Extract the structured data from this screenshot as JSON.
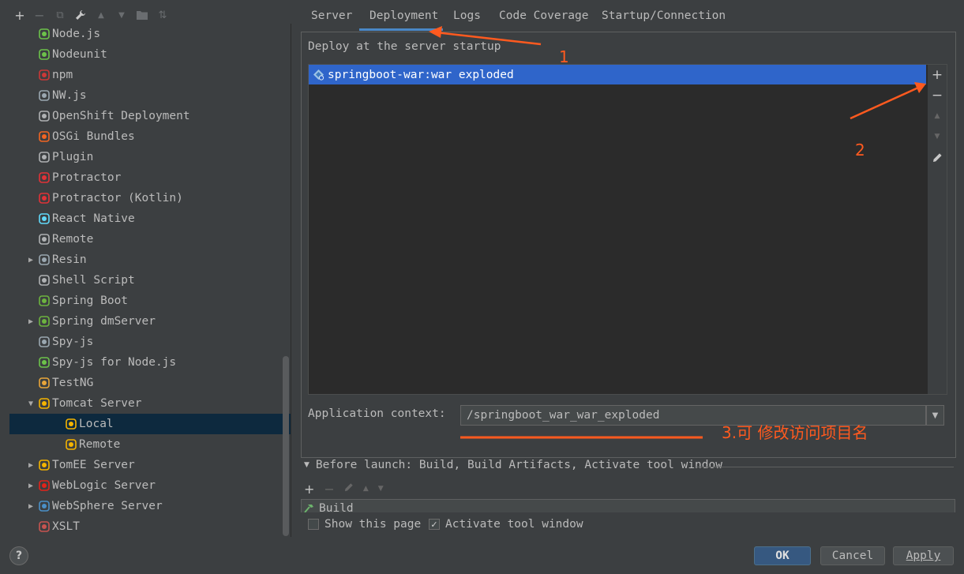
{
  "toolbar": {
    "add": "+",
    "remove": "−",
    "copy": "⧉",
    "settings": "🔧",
    "up": "▲",
    "down": "▼",
    "folder": "📁",
    "sort": "⇅"
  },
  "tree": [
    {
      "label": "Node.js",
      "icon": "nodejs-icon",
      "color": "#6cc24a",
      "arrow": ""
    },
    {
      "label": "Nodeunit",
      "icon": "nodeunit-icon",
      "color": "#6cc24a",
      "arrow": ""
    },
    {
      "label": "npm",
      "icon": "npm-icon",
      "color": "#cb3837",
      "arrow": ""
    },
    {
      "label": "NW.js",
      "icon": "nwjs-icon",
      "color": "#9aa7b0",
      "arrow": ""
    },
    {
      "label": "OpenShift Deployment",
      "icon": "openshift-icon",
      "color": "#afb1b3",
      "arrow": ""
    },
    {
      "label": "OSGi Bundles",
      "icon": "osgi-icon",
      "color": "#f26522",
      "arrow": ""
    },
    {
      "label": "Plugin",
      "icon": "plugin-icon",
      "color": "#afb1b3",
      "arrow": ""
    },
    {
      "label": "Protractor",
      "icon": "protractor-icon",
      "color": "#e23237",
      "arrow": ""
    },
    {
      "label": "Protractor (Kotlin)",
      "icon": "protractor-kotlin-icon",
      "color": "#e23237",
      "arrow": ""
    },
    {
      "label": "React Native",
      "icon": "react-native-icon",
      "color": "#61dafb",
      "arrow": ""
    },
    {
      "label": "Remote",
      "icon": "remote-icon",
      "color": "#afb1b3",
      "arrow": ""
    },
    {
      "label": "Resin",
      "icon": "resin-icon",
      "color": "#9aa7b0",
      "arrow": "▶"
    },
    {
      "label": "Shell Script",
      "icon": "shell-script-icon",
      "color": "#afb1b3",
      "arrow": ""
    },
    {
      "label": "Spring Boot",
      "icon": "spring-boot-icon",
      "color": "#6db33f",
      "arrow": ""
    },
    {
      "label": "Spring dmServer",
      "icon": "spring-dmserver-icon",
      "color": "#6db33f",
      "arrow": "▶"
    },
    {
      "label": "Spy-js",
      "icon": "spyjs-icon",
      "color": "#9aa7b0",
      "arrow": ""
    },
    {
      "label": "Spy-js for Node.js",
      "icon": "spyjs-node-icon",
      "color": "#6cc24a",
      "arrow": ""
    },
    {
      "label": "TestNG",
      "icon": "testng-icon",
      "color": "#e8a53a",
      "arrow": ""
    },
    {
      "label": "Tomcat Server",
      "icon": "tomcat-icon",
      "color": "#f4b400",
      "arrow": "▼"
    },
    {
      "label": "Local",
      "icon": "tomcat-local-icon",
      "color": "#f4b400",
      "arrow": "",
      "child": true,
      "selected": true
    },
    {
      "label": "Remote",
      "icon": "tomcat-remote-icon",
      "color": "#f4b400",
      "arrow": "",
      "child": true
    },
    {
      "label": "TomEE Server",
      "icon": "tomee-icon",
      "color": "#f4b400",
      "arrow": "▶"
    },
    {
      "label": "WebLogic Server",
      "icon": "weblogic-icon",
      "color": "#e2231a",
      "arrow": "▶"
    },
    {
      "label": "WebSphere Server",
      "icon": "websphere-icon",
      "color": "#4a90c7",
      "arrow": "▶"
    },
    {
      "label": "XSLT",
      "icon": "xslt-icon",
      "color": "#c75450",
      "arrow": ""
    }
  ],
  "tabs": {
    "server": "Server",
    "deployment": "Deployment",
    "logs": "Logs",
    "coverage": "Code Coverage",
    "startup": "Startup/Connection"
  },
  "deploy": {
    "title": "Deploy at the server startup",
    "item": "springboot-war:war exploded"
  },
  "context": {
    "label": "Application context:",
    "value": "/springboot_war_war_exploded"
  },
  "annotations": {
    "one": "1",
    "two": "2",
    "three": "3.可 修改访问项目名"
  },
  "before_launch": {
    "label": "Before launch: Build, Build Artifacts, Activate tool window",
    "build": "Build"
  },
  "options": {
    "show_page": "Show this page",
    "activate": "Activate tool window"
  },
  "buttons": {
    "ok": "OK",
    "cancel": "Cancel",
    "apply": "Apply",
    "help": "?"
  },
  "colors": {
    "accent": "#4a88c7",
    "selection": "#2f65ca",
    "annotation": "#ff5a1f"
  }
}
